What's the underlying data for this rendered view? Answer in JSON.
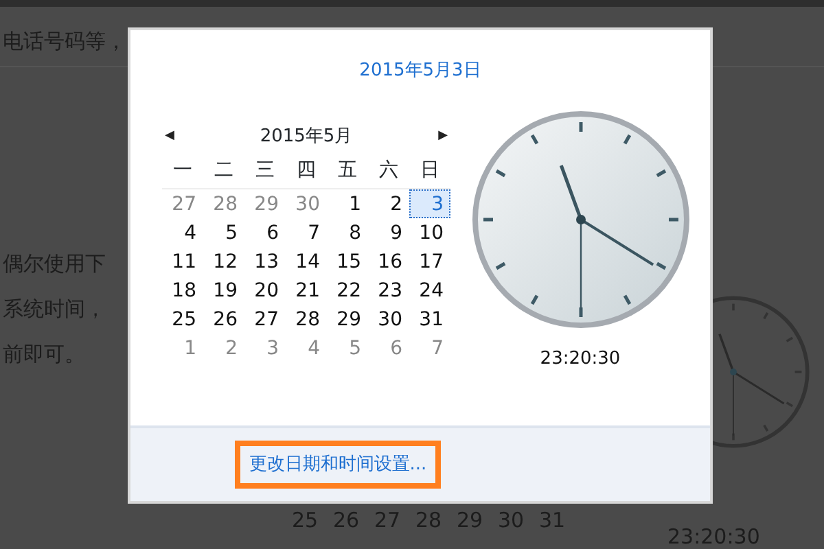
{
  "background": {
    "lines": [
      "电话号码等，",
      "偶尔使用下",
      "系统时间，",
      "前即可。"
    ],
    "calendar_row": [
      "25",
      "26",
      "27",
      "28",
      "29",
      "30",
      "31"
    ],
    "time": "23:20:30"
  },
  "popup": {
    "title": "2015年5月3日",
    "month": "2015年5月",
    "prev": "◀",
    "next": "▶",
    "weekdays": [
      "一",
      "二",
      "三",
      "四",
      "五",
      "六",
      "日"
    ],
    "days": [
      {
        "text": "27",
        "muted": true,
        "selected": false
      },
      {
        "text": "28",
        "muted": true,
        "selected": false
      },
      {
        "text": "29",
        "muted": true,
        "selected": false
      },
      {
        "text": "30",
        "muted": true,
        "selected": false
      },
      {
        "text": "1",
        "muted": false,
        "selected": false
      },
      {
        "text": "2",
        "muted": false,
        "selected": false
      },
      {
        "text": "3",
        "muted": false,
        "selected": true
      },
      {
        "text": "4",
        "muted": false,
        "selected": false
      },
      {
        "text": "5",
        "muted": false,
        "selected": false
      },
      {
        "text": "6",
        "muted": false,
        "selected": false
      },
      {
        "text": "7",
        "muted": false,
        "selected": false
      },
      {
        "text": "8",
        "muted": false,
        "selected": false
      },
      {
        "text": "9",
        "muted": false,
        "selected": false
      },
      {
        "text": "10",
        "muted": false,
        "selected": false
      },
      {
        "text": "11",
        "muted": false,
        "selected": false
      },
      {
        "text": "12",
        "muted": false,
        "selected": false
      },
      {
        "text": "13",
        "muted": false,
        "selected": false
      },
      {
        "text": "14",
        "muted": false,
        "selected": false
      },
      {
        "text": "15",
        "muted": false,
        "selected": false
      },
      {
        "text": "16",
        "muted": false,
        "selected": false
      },
      {
        "text": "17",
        "muted": false,
        "selected": false
      },
      {
        "text": "18",
        "muted": false,
        "selected": false
      },
      {
        "text": "19",
        "muted": false,
        "selected": false
      },
      {
        "text": "20",
        "muted": false,
        "selected": false
      },
      {
        "text": "21",
        "muted": false,
        "selected": false
      },
      {
        "text": "22",
        "muted": false,
        "selected": false
      },
      {
        "text": "23",
        "muted": false,
        "selected": false
      },
      {
        "text": "24",
        "muted": false,
        "selected": false
      },
      {
        "text": "25",
        "muted": false,
        "selected": false
      },
      {
        "text": "26",
        "muted": false,
        "selected": false
      },
      {
        "text": "27",
        "muted": false,
        "selected": false
      },
      {
        "text": "28",
        "muted": false,
        "selected": false
      },
      {
        "text": "29",
        "muted": false,
        "selected": false
      },
      {
        "text": "30",
        "muted": false,
        "selected": false
      },
      {
        "text": "31",
        "muted": false,
        "selected": false
      },
      {
        "text": "1",
        "muted": true,
        "selected": false
      },
      {
        "text": "2",
        "muted": true,
        "selected": false
      },
      {
        "text": "3",
        "muted": true,
        "selected": false
      },
      {
        "text": "4",
        "muted": true,
        "selected": false
      },
      {
        "text": "5",
        "muted": true,
        "selected": false
      },
      {
        "text": "6",
        "muted": true,
        "selected": false
      },
      {
        "text": "7",
        "muted": true,
        "selected": false
      }
    ],
    "time": "23:20:30",
    "link": "更改日期和时间设置..."
  }
}
